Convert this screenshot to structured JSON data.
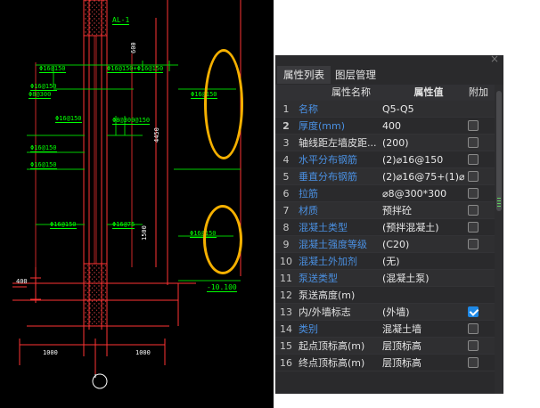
{
  "cad": {
    "labels": [
      {
        "text": "AL-1",
        "color": "#00ff00"
      },
      {
        "text": "Φ16@150",
        "color": "#00ff00"
      },
      {
        "text": "Φ16@150+Φ16@150",
        "color": "#00ff00"
      },
      {
        "text": "Φ16@150",
        "color": "#00ff00"
      },
      {
        "text": "Φ8@300",
        "color": "#00ff00"
      },
      {
        "text": "Φ16@150",
        "color": "#00ff00"
      },
      {
        "text": "Φ16@150",
        "color": "#00ff00"
      },
      {
        "text": "Φ8@300@150",
        "color": "#00ff00"
      },
      {
        "text": "Φ16@150",
        "color": "#00ff00"
      },
      {
        "text": "Φ16@150",
        "color": "#00ff00"
      },
      {
        "text": "Φ16@75",
        "color": "#00ff00"
      },
      {
        "text": "Φ16@150",
        "color": "#00ff00"
      },
      {
        "text": "Φ16@150",
        "color": "#00ff00"
      },
      {
        "text": "-10.100",
        "color": "#00ff00"
      },
      {
        "text": "400",
        "color": "#ffffff"
      },
      {
        "text": "1000",
        "color": "#ffffff"
      },
      {
        "text": "1000",
        "color": "#ffffff"
      },
      {
        "text": "4450",
        "color": "#ffffff"
      },
      {
        "text": "1500",
        "color": "#ffffff"
      },
      {
        "text": "600",
        "color": "#ffffff"
      }
    ],
    "highlight_color": "#f5b000"
  },
  "panel": {
    "close_label": "×",
    "tabs": [
      {
        "label": "属性列表",
        "active": true
      },
      {
        "label": "图层管理",
        "active": false
      }
    ],
    "columns": {
      "name": "属性名称",
      "value": "属性值",
      "extra": "附加"
    },
    "rows": [
      {
        "index": "1",
        "name": "名称",
        "value": "Q5-Q5",
        "link": true,
        "checkbox": false,
        "checked": false
      },
      {
        "index": "2",
        "name": "厚度(mm)",
        "value": "400",
        "link": true,
        "checkbox": true,
        "checked": false,
        "bold_index": true
      },
      {
        "index": "3",
        "name": "轴线距左墙皮距...",
        "value": "(200)",
        "link": false,
        "checkbox": true,
        "checked": false
      },
      {
        "index": "4",
        "name": "水平分布钢筋",
        "value": "(2)⌀16@150",
        "link": true,
        "checkbox": true,
        "checked": false
      },
      {
        "index": "5",
        "name": "垂直分布钢筋",
        "value": "(2)⌀16@75+(1)⌀",
        "link": true,
        "checkbox": true,
        "checked": false
      },
      {
        "index": "6",
        "name": "拉筋",
        "value": "⌀8@300*300",
        "link": true,
        "checkbox": true,
        "checked": false
      },
      {
        "index": "7",
        "name": "材质",
        "value": "预拌砼",
        "link": true,
        "checkbox": true,
        "checked": false
      },
      {
        "index": "8",
        "name": "混凝土类型",
        "value": "(预拌混凝土)",
        "link": true,
        "checkbox": true,
        "checked": false
      },
      {
        "index": "9",
        "name": "混凝土强度等级",
        "value": "(C20)",
        "link": true,
        "checkbox": true,
        "checked": false
      },
      {
        "index": "10",
        "name": "混凝土外加剂",
        "value": "(无)",
        "link": true,
        "checkbox": false,
        "checked": false
      },
      {
        "index": "11",
        "name": "泵送类型",
        "value": "(混凝土泵)",
        "link": true,
        "checkbox": false,
        "checked": false
      },
      {
        "index": "12",
        "name": "泵送高度(m)",
        "value": "",
        "link": false,
        "checkbox": false,
        "checked": false
      },
      {
        "index": "13",
        "name": "内/外墙标志",
        "value": "(外墙)",
        "link": false,
        "checkbox": true,
        "checked": true
      },
      {
        "index": "14",
        "name": "类别",
        "value": "混凝土墙",
        "link": true,
        "checkbox": true,
        "checked": false
      },
      {
        "index": "15",
        "name": "起点顶标高(m)",
        "value": "层顶标高",
        "link": false,
        "checkbox": true,
        "checked": false
      },
      {
        "index": "16",
        "name": "终点顶标高(m)",
        "value": "层顶标高",
        "link": false,
        "checkbox": true,
        "checked": false
      }
    ]
  }
}
